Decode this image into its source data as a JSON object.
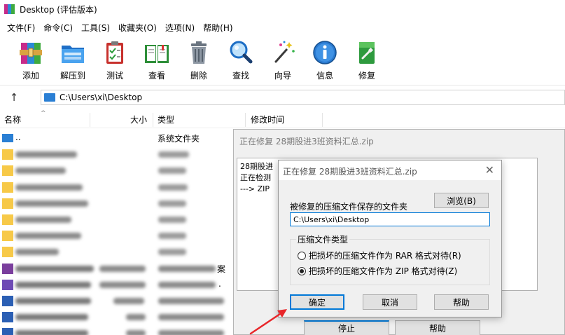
{
  "window": {
    "title": "Desktop (评估版本)"
  },
  "menu": [
    "文件(F)",
    "命令(C)",
    "工具(S)",
    "收藏夹(O)",
    "选项(N)",
    "帮助(H)"
  ],
  "toolbar": [
    {
      "label": "添加",
      "icon": "add-archive-icon"
    },
    {
      "label": "解压到",
      "icon": "extract-folder-icon"
    },
    {
      "label": "测试",
      "icon": "test-clipboard-icon"
    },
    {
      "label": "查看",
      "icon": "view-book-icon"
    },
    {
      "label": "删除",
      "icon": "trash-icon"
    },
    {
      "label": "查找",
      "icon": "magnifier-icon"
    },
    {
      "label": "向导",
      "icon": "wizard-wand-icon"
    },
    {
      "label": "信息",
      "icon": "info-icon"
    },
    {
      "label": "修复",
      "icon": "repair-kit-icon"
    }
  ],
  "address": {
    "path": "C:\\Users\\xi\\Desktop"
  },
  "columns": {
    "name": "名称",
    "size": "大小",
    "type": "类型",
    "modified": "修改时间"
  },
  "files": [
    {
      "name": "..",
      "type": "系统文件夹"
    }
  ],
  "partial_text": {
    "row9_type_tail": "案",
    "row10_type_tail": "."
  },
  "repair_dialog_bg": {
    "title": "正在修复 28期股进3班资料汇总.zip",
    "log": [
      "28期股进",
      "正在检测",
      "---> ZIP"
    ],
    "stop_label": "停止",
    "help_label": "帮助"
  },
  "repair_dialog": {
    "title": "正在修复 28期股进3班资料汇总.zip",
    "folder_label": "被修复的压缩文件保存的文件夹",
    "browse_label": "浏览(B)",
    "folder_path": "C:\\Users\\xi\\Desktop",
    "type_group_label": "压缩文件类型",
    "option_rar": "把损坏的压缩文件作为 RAR 格式对待(R)",
    "option_zip": "把损坏的压缩文件作为 ZIP 格式对待(Z)",
    "selected_option": "zip",
    "ok_label": "确定",
    "cancel_label": "取消",
    "help_label": "帮助"
  },
  "colors": {
    "accent_blue": "#0078d7",
    "annotation_arrow": "#e8262a",
    "folder_yellow": "#f7c948"
  }
}
